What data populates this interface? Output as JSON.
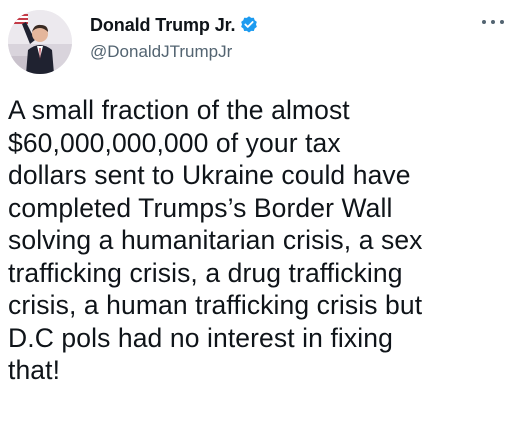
{
  "tweet": {
    "author": {
      "display_name": "Donald Trump Jr.",
      "handle": "@DonaldJTrumpJr",
      "verified": true
    },
    "more_icon": "more-horizontal-icon",
    "text": "A small fraction of the almost\n$60,000,000,000 of your tax\ndollars sent to Ukraine could have\ncompleted Trumps’s Border Wall\nsolving a humanitarian crisis, a sex\ntrafficking crisis, a drug trafficking\ncrisis, a human trafficking crisis but\nD.C pols had no interest in fixing\nthat!"
  },
  "colors": {
    "text": "#0f1419",
    "secondary_text": "#536471",
    "verified_badge": "#1d9bf0",
    "background": "#ffffff"
  }
}
